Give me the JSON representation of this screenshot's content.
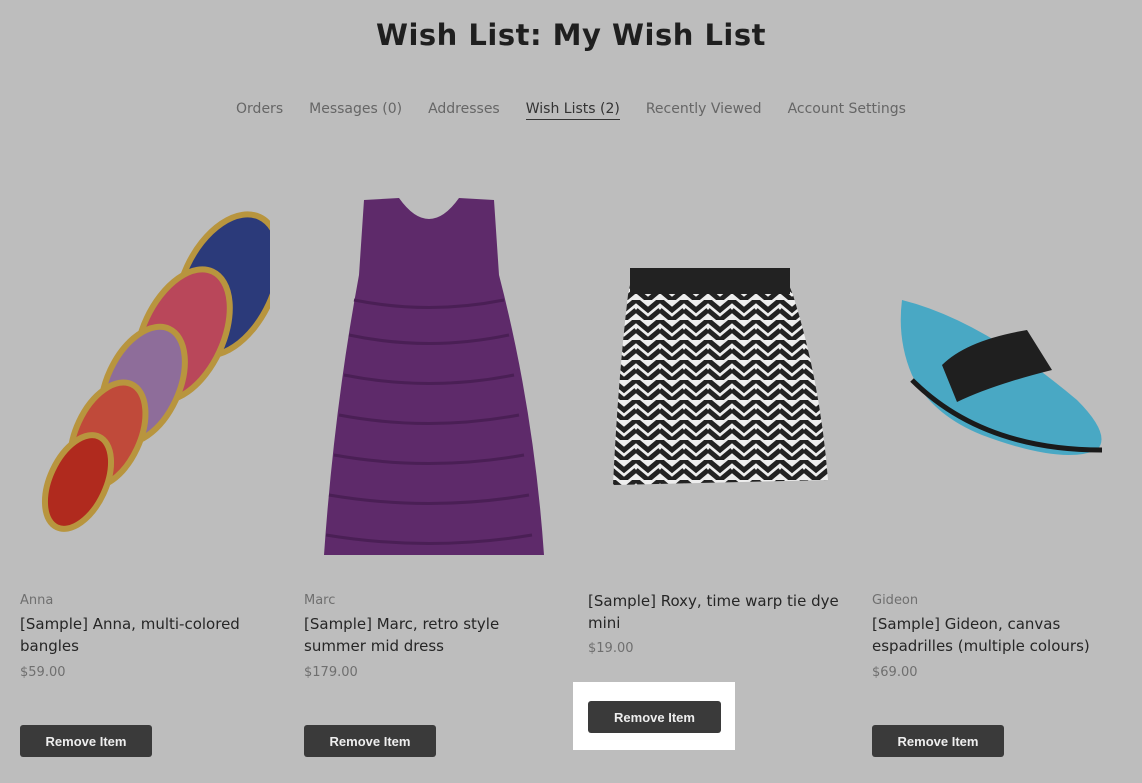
{
  "page": {
    "title": "Wish List: My Wish List"
  },
  "nav": {
    "items": [
      {
        "label": "Orders"
      },
      {
        "label": "Messages (0)"
      },
      {
        "label": "Addresses"
      },
      {
        "label": "Wish Lists (2)",
        "active": true
      },
      {
        "label": "Recently Viewed"
      },
      {
        "label": "Account Settings"
      }
    ]
  },
  "products": [
    {
      "brand": "Anna",
      "name": "[Sample] Anna, multi-colored bangles",
      "price": "$59.00",
      "button": "Remove Item",
      "image_icon": "bangles-image"
    },
    {
      "brand": "Marc",
      "name": "[Sample] Marc, retro style summer mid dress",
      "price": "$179.00",
      "button": "Remove Item",
      "image_icon": "dress-image"
    },
    {
      "brand": "",
      "name": "[Sample] Roxy, time warp tie dye mini",
      "price": "$19.00",
      "button": "Remove Item",
      "image_icon": "skirt-image",
      "highlighted": true
    },
    {
      "brand": "Gideon",
      "name": "[Sample] Gideon, canvas espadrilles (multiple colours)",
      "price": "$69.00",
      "button": "Remove Item",
      "image_icon": "espadrille-image"
    }
  ],
  "colors": {
    "overlay": "#bdbdbd",
    "button": "#3a3a3a",
    "highlight": "#ffffff"
  }
}
